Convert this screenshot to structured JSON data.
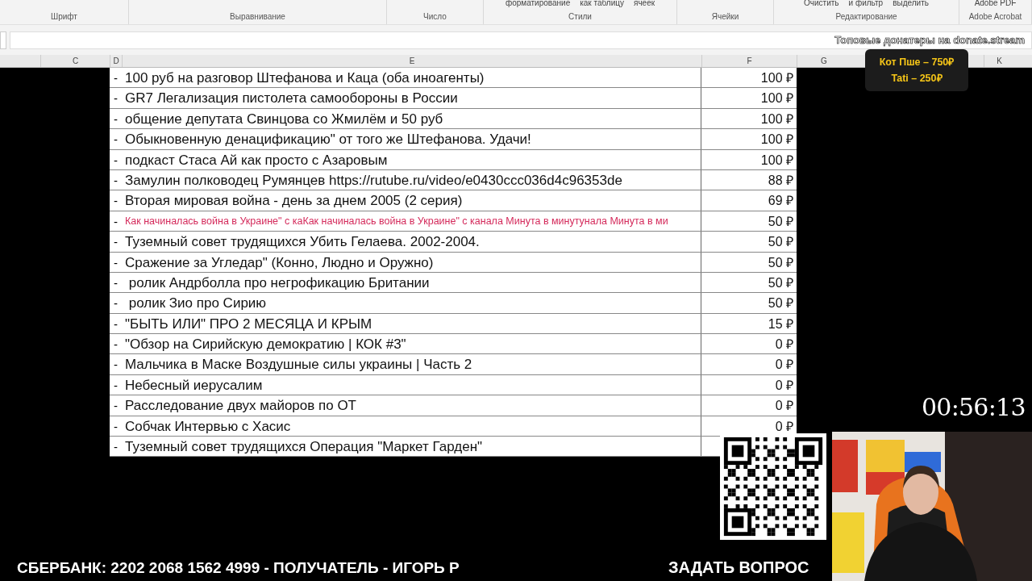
{
  "ribbon": {
    "groups": [
      {
        "label": "Шрифт"
      },
      {
        "label": "Выравнивание"
      },
      {
        "label": "Число"
      },
      {
        "label": "Стили",
        "buttons": [
          "форматирование",
          "как таблицу",
          "ячеек"
        ]
      },
      {
        "label": "Ячейки"
      },
      {
        "label": "Редактирование",
        "buttons": [
          "Очистить",
          "и фильтр",
          "выделить"
        ]
      },
      {
        "label": "Adobe Acrobat",
        "buttons": [
          "Adobe PDF"
        ]
      }
    ]
  },
  "overlay_title": "Топовые донатеры на donate.stream",
  "top_donors": [
    "Кот Пше – 750₽",
    "Tati – 250₽"
  ],
  "columns": [
    "C",
    "D",
    "E",
    "F",
    "G",
    "K"
  ],
  "rows": [
    {
      "mark": "-",
      "title": "100 руб на разговор Штефанова и Каца (оба иноагенты)",
      "amount": "100 ₽"
    },
    {
      "mark": "-",
      "title": "GR7 Легализация пистолета самообороны в России",
      "amount": "100 ₽"
    },
    {
      "mark": "-",
      "title": "общение депутата Свинцова со Жмилём и 50 руб",
      "amount": "100 ₽"
    },
    {
      "mark": "-",
      "title": "Обыкновенную денацификацию\" от того же Штефанова. Удачи!",
      "amount": "100 ₽"
    },
    {
      "mark": "-",
      "title": "подкаст Стаса Ай как просто с Азаровым",
      "amount": "100 ₽"
    },
    {
      "mark": "-",
      "title": "Замулин полководец Румянцев https://rutube.ru/video/e0430ccc036d4c96353de",
      "amount": "88 ₽"
    },
    {
      "mark": "-",
      "title": "Вторая мировая война - день за днем 2005 (2 серия)",
      "amount": "69 ₽"
    },
    {
      "mark": "-",
      "title": "Как начиналась война в Украине\" с каКак начиналась война в Украине\" с канала Минута в минутунала Минута в ми",
      "amount": "50 ₽",
      "color": "#d42a5b"
    },
    {
      "mark": "-",
      "title": "Туземный совет трудящихся Убить Гелаева. 2002-2004.",
      "amount": "50 ₽"
    },
    {
      "mark": "-",
      "title": "Сражение за Угледар\" (Конно, Людно и Оружно)",
      "amount": "50 ₽"
    },
    {
      "mark": "-",
      "title": " ролик Андрболла про негрофикацию Британии",
      "amount": "50 ₽"
    },
    {
      "mark": "-",
      "title": " ролик Зио про Сирию",
      "amount": "50 ₽"
    },
    {
      "mark": "-",
      "title": "\"БЫТЬ ИЛИ\" ПРО 2 МЕСЯЦА И КРЫМ",
      "amount": "15 ₽"
    },
    {
      "mark": "-",
      "title": "\"Обзор на Сирийскую демократию | КОК #3\"",
      "amount": "0 ₽"
    },
    {
      "mark": "-",
      "title": "Мальчика в Маске Воздушные силы украины | Часть 2",
      "amount": "0 ₽"
    },
    {
      "mark": "-",
      "title": "Небесный иерусалим",
      "amount": "0 ₽"
    },
    {
      "mark": "-",
      "title": "Расследование двух майоров по ОТ",
      "amount": "0 ₽"
    },
    {
      "mark": "-",
      "title": "Собчак Интервью с Хасис",
      "amount": "0 ₽"
    },
    {
      "mark": "-",
      "title": "Туземный совет трудящихся Операция \"Маркет Гарден\""
    }
  ],
  "timer": "00:56:13",
  "bank_line": "СБЕРБАНК: 2202 2068 1562 4999 - ПОЛУЧАТЕЛЬ - ИГОРЬ Р",
  "ask_label": "ЗАДАТЬ ВОПРОС"
}
